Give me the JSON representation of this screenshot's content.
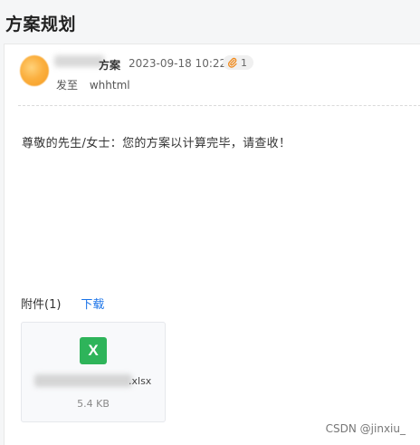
{
  "page": {
    "title": "方案规划"
  },
  "email": {
    "sender_name": "方案",
    "timestamp": "2023-09-18 10:22",
    "attachment_count": "1",
    "to_label": "发至",
    "to_value": "whhtml",
    "body": "尊敬的先生/女士：您的方案以计算完毕，请查收！"
  },
  "attachments": {
    "header_label": "附件(1)",
    "download_label": "下载",
    "files": [
      {
        "icon": "X",
        "name_ext": ".xlsx",
        "size": "5.4 KB"
      }
    ]
  },
  "watermark": "CSDN @jinxiu_",
  "colors": {
    "excel_green": "#2eb45a",
    "link_blue": "#1a73e8",
    "avatar_orange": "#f59a1e"
  }
}
